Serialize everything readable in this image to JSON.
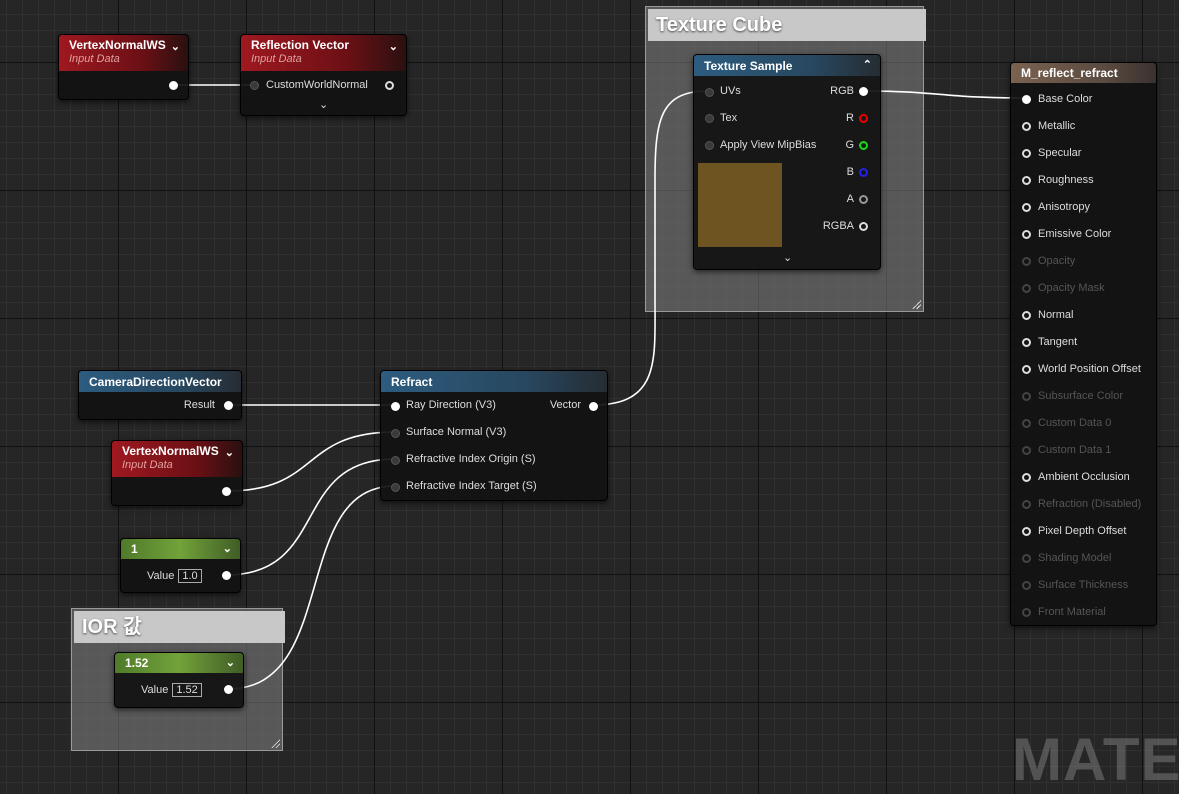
{
  "comments": {
    "texture_cube": "Texture Cube",
    "ior": "IOR 값"
  },
  "nodes": {
    "vertex_normal_top": {
      "title": "VertexNormalWS",
      "subtitle": "Input Data"
    },
    "reflection_vector": {
      "title": "Reflection Vector",
      "subtitle": "Input Data",
      "input": "CustomWorldNormal"
    },
    "texture_sample": {
      "title": "Texture Sample",
      "inputs": [
        "UVs",
        "Tex",
        "Apply View MipBias"
      ],
      "outputs": [
        "RGB",
        "R",
        "G",
        "B",
        "A",
        "RGBA"
      ],
      "preview_color": "#6e5420"
    },
    "camera_direction": {
      "title": "CameraDirectionVector",
      "output": "Result"
    },
    "vertex_normal_bottom": {
      "title": "VertexNormalWS",
      "subtitle": "Input Data"
    },
    "refract": {
      "title": "Refract",
      "inputs": [
        "Ray Direction (V3)",
        "Surface Normal (V3)",
        "Refractive Index Origin (S)",
        "Refractive Index Target (S)"
      ],
      "output": "Vector"
    },
    "const_1": {
      "title": "1",
      "value_label": "Value",
      "value": "1.0"
    },
    "const_ior": {
      "title": "1.52",
      "value_label": "Value",
      "value": "1.52"
    },
    "material": {
      "title": "M_reflect_refract",
      "inputs": [
        {
          "label": "Base Color",
          "enabled": true
        },
        {
          "label": "Metallic",
          "enabled": true
        },
        {
          "label": "Specular",
          "enabled": true
        },
        {
          "label": "Roughness",
          "enabled": true
        },
        {
          "label": "Anisotropy",
          "enabled": true
        },
        {
          "label": "Emissive Color",
          "enabled": true
        },
        {
          "label": "Opacity",
          "enabled": false
        },
        {
          "label": "Opacity Mask",
          "enabled": false
        },
        {
          "label": "Normal",
          "enabled": true
        },
        {
          "label": "Tangent",
          "enabled": true
        },
        {
          "label": "World Position Offset",
          "enabled": true
        },
        {
          "label": "Subsurface Color",
          "enabled": false
        },
        {
          "label": "Custom Data 0",
          "enabled": false
        },
        {
          "label": "Custom Data 1",
          "enabled": false
        },
        {
          "label": "Ambient Occlusion",
          "enabled": true
        },
        {
          "label": "Refraction (Disabled)",
          "enabled": false
        },
        {
          "label": "Pixel Depth Offset",
          "enabled": true
        },
        {
          "label": "Shading Model",
          "enabled": false
        },
        {
          "label": "Surface Thickness",
          "enabled": false
        },
        {
          "label": "Front Material",
          "enabled": false
        }
      ]
    }
  },
  "watermark": "MATER",
  "colors": {
    "wire": "#ffffff",
    "grid_major": "#111111",
    "grid_minor": "#303030"
  }
}
